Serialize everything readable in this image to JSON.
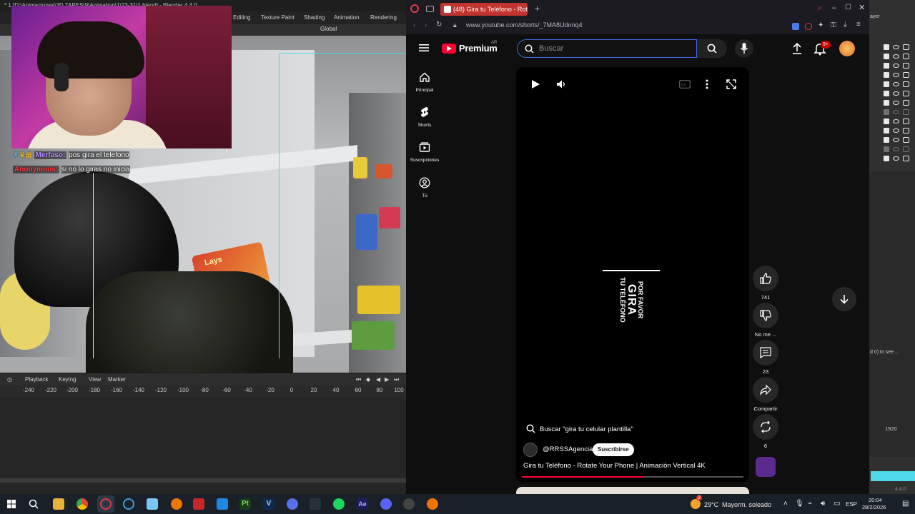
{
  "blender": {
    "title": "* 1 [D:\\Animaciones\\3D TAPES\\9\\Animation\\1\\23-31\\1.blend] - Blender 4.4.0",
    "workspaces": [
      "Editing",
      "Texture Paint",
      "Shading",
      "Animation",
      "Rendering"
    ],
    "orientation": "Global",
    "timeline_menu": [
      "Playback",
      "Keying",
      "View",
      "Marker"
    ],
    "ruler_ticks": [
      "-240",
      "-220",
      "-200",
      "-180",
      "-160",
      "-140",
      "-120",
      "-100",
      "-80",
      "-60",
      "-40",
      "-20",
      "0",
      "20",
      "40",
      "60",
      "80",
      "100"
    ],
    "scene_product_label": "Lays"
  },
  "chat": [
    {
      "user": "Merfaso:",
      "message": "pos gira el telefono",
      "color": "#b78cff"
    },
    {
      "user": "Anonymous:",
      "message": "si no lo giras no inicia",
      "color": "#ff3b3b"
    }
  ],
  "browser": {
    "tab_title": "(48) Gira tu Teléfono - Rota",
    "url": "www.youtube.com/shorts/_7MA8Udnnq4"
  },
  "youtube": {
    "logo": "Premium",
    "country": "AR",
    "search_placeholder": "Buscar",
    "notifications": "9+",
    "guide": [
      {
        "label": "Principal",
        "icon": "home-icon"
      },
      {
        "label": "Shorts",
        "icon": "shorts-icon"
      },
      {
        "label": "Suscripciones",
        "icon": "subscriptions-icon"
      },
      {
        "label": "Tú",
        "icon": "you-icon"
      }
    ],
    "video_overlay": {
      "line1": "POR FAVOR",
      "line2": "GIRA",
      "line3": "TU TELÉFONO"
    },
    "search_suggestion": "Buscar \"gira tu celular plantilla\"",
    "channel": "@RRSSAgencia",
    "subscribe": "Suscribirse",
    "video_title": "Gira tu Teléfono - Rotate Your Phone | Animación Vertical 4K",
    "progress_fraction": 0.55,
    "likes": "741",
    "dislike": "No me ...",
    "comments": "23",
    "share": "Compartir",
    "remix": "6"
  },
  "outliner": {
    "label_top": "ayer",
    "label_mid": "d 0) to see ...",
    "value": "1920",
    "version": "4.4.0"
  },
  "taskbar": {
    "weather_badge": "2",
    "temperature": "29°C",
    "weather": "Mayorm. soleado",
    "language": "ESP",
    "time": "20:04",
    "date": "28/2/2026"
  }
}
